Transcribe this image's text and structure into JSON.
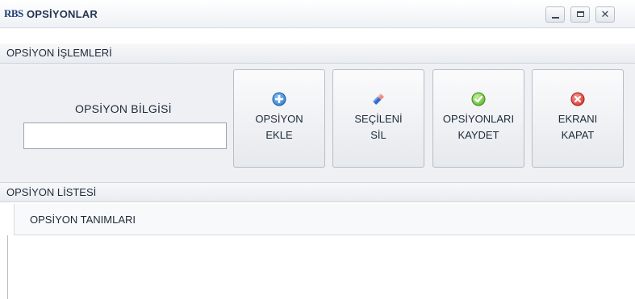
{
  "window": {
    "logo": "RBS",
    "title": "OPSİYONLAR",
    "controls": {
      "minimize": "minimize-icon",
      "maximize": "maximize-icon",
      "close": "✕"
    }
  },
  "operations_group": {
    "header": "OPSİYON İŞLEMLERİ",
    "info_label": "OPSİYON BİLGİSİ",
    "info_value": "",
    "buttons": [
      {
        "line1": "OPSİYON",
        "line2": "EKLE",
        "icon": "add-icon",
        "color": "#2f7fd1"
      },
      {
        "line1": "SEÇİLENİ",
        "line2": "SİL",
        "icon": "eraser-icon",
        "color": "#2f6bd1"
      },
      {
        "line1": "OPSİYONLARI",
        "line2": "KAYDET",
        "icon": "check-icon",
        "color": "#5cb82e"
      },
      {
        "line1": "EKRANI",
        "line2": "KAPAT",
        "icon": "close-circle-icon",
        "color": "#d9352b"
      }
    ]
  },
  "list_group": {
    "header": "OPSİYON LİSTESİ",
    "column_header": "OPSİYON TANIMLARI",
    "rows": []
  }
}
